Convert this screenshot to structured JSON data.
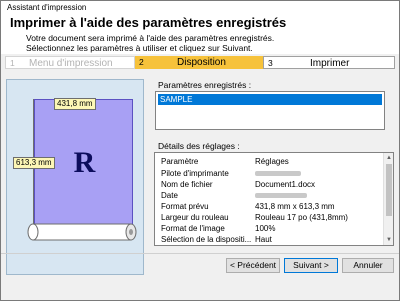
{
  "window": {
    "title": "Assistant d'impression"
  },
  "header": {
    "title": "Imprimer à l'aide des paramètres enregistrés",
    "description_line1": "Votre document sera imprimé à l'aide des paramètres enregistrés.",
    "description_line2": "Sélectionnez les paramètres à utiliser et cliquez sur Suivant."
  },
  "steps": [
    {
      "number": "1",
      "label": "Menu d'impression",
      "state": "done"
    },
    {
      "number": "2",
      "label": "Disposition",
      "state": "active"
    },
    {
      "number": "3",
      "label": "Imprimer",
      "state": "pending"
    }
  ],
  "preview": {
    "width_label": "431,8 mm",
    "height_label": "613,3 mm",
    "letter": "R"
  },
  "saved": {
    "label": "Paramètres enregistrés :",
    "items": [
      "SAMPLE"
    ]
  },
  "details": {
    "label": "Détails des réglages :",
    "header": {
      "key": "Paramètre",
      "value": "Réglages"
    },
    "rows": [
      {
        "key": "Pilote d'imprimante",
        "value": ""
      },
      {
        "key": "Nom de fichier",
        "value": "Document1.docx"
      },
      {
        "key": "Date",
        "value": ""
      },
      {
        "key": "Format prévu",
        "value": "431,8 mm x 613,3 mm"
      },
      {
        "key": "Largeur du rouleau",
        "value": "Rouleau 17 po (431,8mm)"
      },
      {
        "key": "Format de l'image",
        "value": "100%"
      },
      {
        "key": "Sélection de la dispositi...",
        "value": "Haut"
      }
    ]
  },
  "buttons": {
    "prev": "< Précédent",
    "next": "Suivant >",
    "cancel": "Annuler"
  },
  "colors": {
    "accent_step": "#f6c23b",
    "selection": "#0078d7",
    "paper_area": "#a8a0f4",
    "preview_bg": "#d7e6f2"
  }
}
